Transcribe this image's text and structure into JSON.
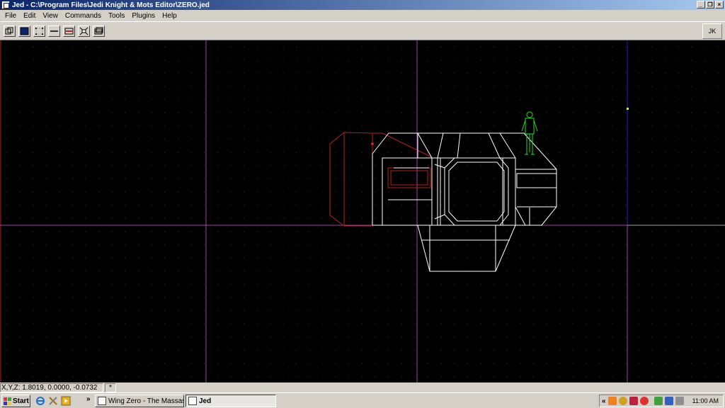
{
  "window": {
    "title": "Jed - C:\\Program Files\\Jedi Knight & Mots Editor\\ZERO.jed"
  },
  "window_buttons": {
    "minimize": "_",
    "restore": "❐",
    "close": "×"
  },
  "menu": [
    "File",
    "Edit",
    "View",
    "Commands",
    "Tools",
    "Plugins",
    "Help"
  ],
  "toolbar": {
    "jk_label": "JK"
  },
  "status": {
    "coords": "X,Y,Z: 1.8019, 0.0000, -0.0732",
    "flag": "*"
  },
  "taskbar": {
    "start_label": "Start",
    "quick_chevron": "»",
    "tasks": [
      {
        "label": "Wing Zero - The Massass..."
      },
      {
        "label": "Jed"
      }
    ],
    "tray_chevron": "«",
    "clock": "11:00 AM"
  },
  "colors": {
    "grid_axis": "#a040a0",
    "geometry": "#ffffff",
    "selected_sector": "#b02020",
    "player": "#20e020",
    "blue_guide": "#2020c0",
    "titlebar_start": "#0a246a"
  },
  "icons": [
    "jed-app-icon",
    "view-3d-icon",
    "sector-icon",
    "vertex-icon",
    "edge-icon",
    "surface-icon",
    "thing-icon",
    "lights-icon",
    "windows-flag-icon",
    "ie-icon",
    "tray-icons"
  ]
}
